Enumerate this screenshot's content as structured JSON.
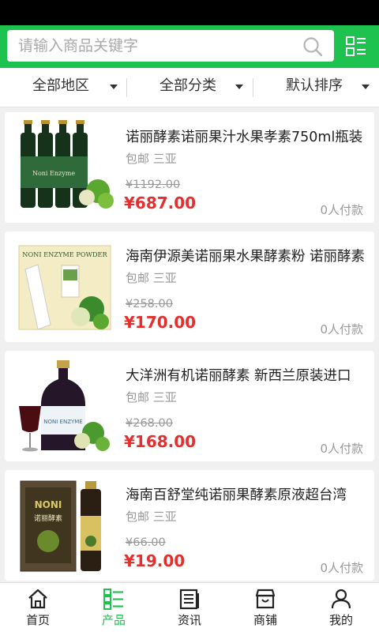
{
  "search": {
    "placeholder": "请输入商品关键字"
  },
  "filters": [
    {
      "label": "全部地区"
    },
    {
      "label": "全部分类"
    },
    {
      "label": "默认排序"
    }
  ],
  "products": [
    {
      "title": "诺丽酵素诺丽果汁水果孝素750ml瓶装",
      "shipping": "包邮",
      "location": "三亚",
      "original_price": "¥1192.00",
      "price": "¥687.00",
      "sales": "0人付款"
    },
    {
      "title": "海南伊源美诺丽果水果酵素粉 诺丽酵素",
      "shipping": "包邮",
      "location": "三亚",
      "original_price": "¥258.00",
      "price": "¥170.00",
      "sales": "0人付款"
    },
    {
      "title": "大洋洲有机诺丽酵素 新西兰原装进口",
      "shipping": "包邮",
      "location": "三亚",
      "original_price": "¥268.00",
      "price": "¥168.00",
      "sales": "0人付款"
    },
    {
      "title": "海南百舒堂纯诺丽果酵素原液超台湾",
      "shipping": "包邮",
      "location": "三亚",
      "original_price": "¥66.00",
      "price": "¥19.00",
      "sales": "0人付款"
    }
  ],
  "image_text": {
    "p1_label": "Noni Enzyme",
    "p2_box": "NONI ENZYME POWDER",
    "p3_label": "NONI ENZYME",
    "p4_box": "NONI",
    "p4_box_cn": "诺丽酵素"
  },
  "tabs": [
    {
      "label": "首页",
      "icon": "home-icon"
    },
    {
      "label": "产品",
      "icon": "list-icon",
      "active": true
    },
    {
      "label": "资讯",
      "icon": "news-icon"
    },
    {
      "label": "商铺",
      "icon": "shop-icon"
    },
    {
      "label": "我的",
      "icon": "user-icon"
    }
  ],
  "colors": {
    "brand_green": "#1ec34f",
    "price_red": "#e52e2e",
    "muted": "#999999"
  }
}
